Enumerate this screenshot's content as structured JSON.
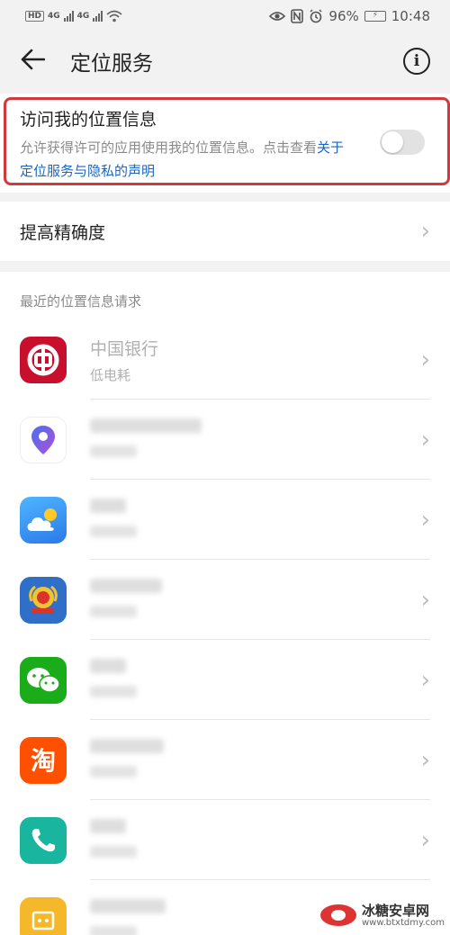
{
  "status_bar": {
    "hd": "HD",
    "net1": "4G",
    "net2": "4G",
    "battery_percent": "96%",
    "time": "10:48"
  },
  "app_bar": {
    "title": "定位服务",
    "info_glyph": "i"
  },
  "location_access": {
    "title": "访问我的位置信息",
    "description": "允许获得许可的应用使用我的位置信息。点击查看",
    "link": "关于定位服务与隐私的声明",
    "toggle_on": false
  },
  "accuracy": {
    "label": "提高精确度"
  },
  "recent": {
    "header": "最近的位置信息请求",
    "first_app": {
      "name": "中国银行",
      "power": "低电耗"
    }
  },
  "colors": {
    "highlight_box": "#d23a3a",
    "link": "#1a66c4",
    "boc_red": "#c8102e",
    "maps_purple": "#7b4fd6",
    "weather_blue": "#2b8ff0",
    "tax_blue": "#2f6fc8",
    "wechat_green": "#1aad19",
    "taobao_orange": "#ff5000",
    "phone_teal": "#19b59f",
    "files_yellow": "#f5b82a"
  },
  "icons": [
    "back-arrow-icon",
    "info-icon",
    "chevron-right-icon",
    "boc-icon",
    "map-pin-icon",
    "weather-icon",
    "tax-icon",
    "wechat-icon",
    "taobao-icon",
    "phone-icon",
    "files-icon"
  ],
  "watermark": {
    "name": "冰糖安卓网",
    "url": "www.btxtdmy.com"
  }
}
